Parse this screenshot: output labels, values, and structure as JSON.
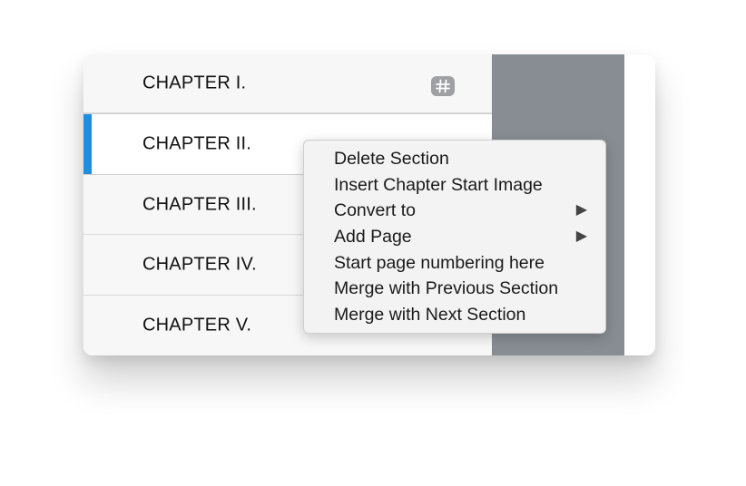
{
  "chapters": [
    {
      "label": "CHAPTER I.",
      "selected": false,
      "icon": "hash-icon"
    },
    {
      "label": "CHAPTER II.",
      "selected": true
    },
    {
      "label": "CHAPTER III.",
      "selected": false
    },
    {
      "label": "CHAPTER IV.",
      "selected": false
    },
    {
      "label": "CHAPTER V.",
      "selected": false
    }
  ],
  "context_menu": {
    "items": [
      {
        "label": "Delete Section",
        "submenu": false
      },
      {
        "label": "Insert Chapter Start Image",
        "submenu": false
      },
      {
        "label": "Convert to",
        "submenu": true
      },
      {
        "label": "Add Page",
        "submenu": true
      },
      {
        "label": "Start page numbering here",
        "submenu": false
      },
      {
        "label": "Merge with Previous Section",
        "submenu": false
      },
      {
        "label": "Merge with Next Section",
        "submenu": false
      }
    ],
    "submenu_arrow": "▶"
  },
  "colors": {
    "selection_accent": "#1e8fe0",
    "preview_panel": "#878d93",
    "menu_background": "#f3f3f3"
  }
}
